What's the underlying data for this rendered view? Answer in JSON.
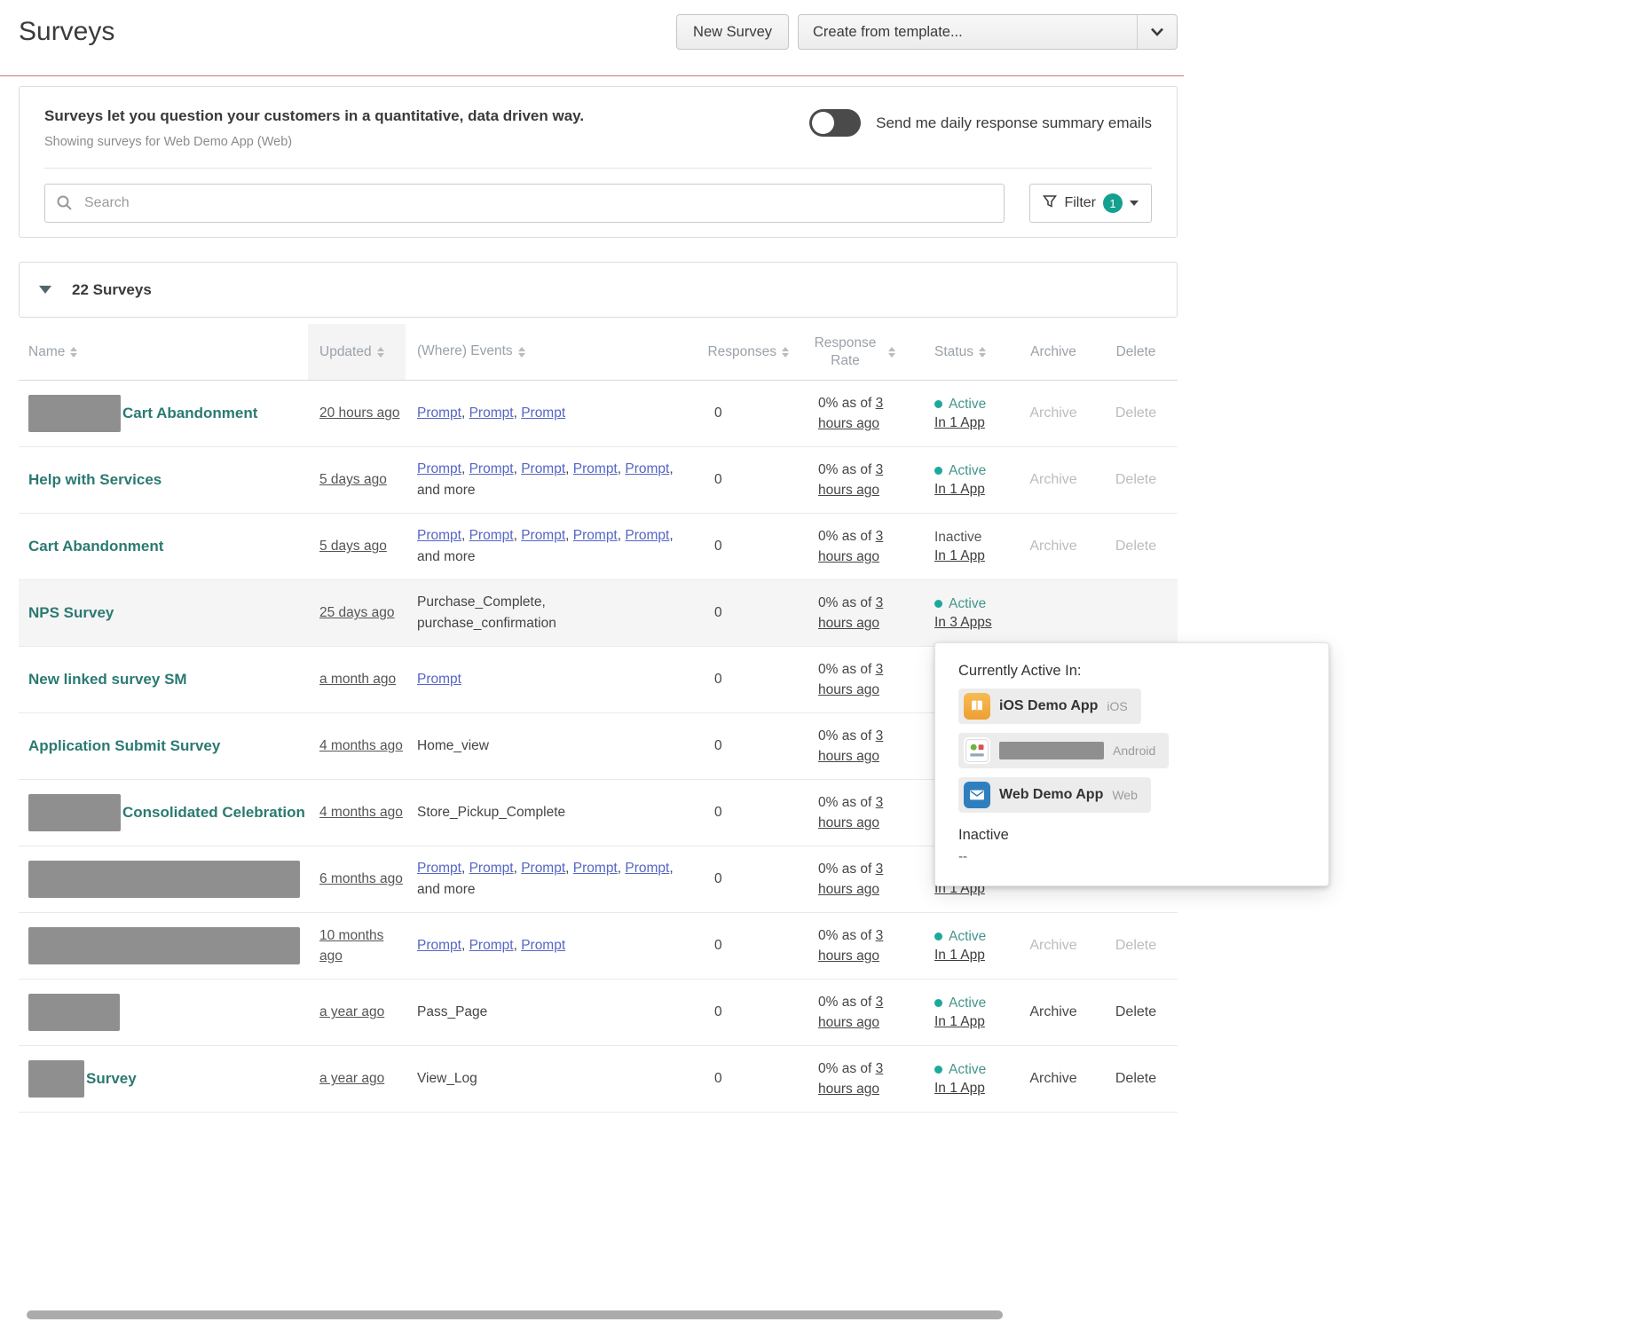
{
  "page": {
    "title": "Surveys",
    "new_survey_button": "New Survey",
    "template_dropdown": "Create from template..."
  },
  "banner": {
    "headline": "Surveys let you question your customers in a quantitative, data driven way.",
    "subtext": "Showing surveys for Web Demo App (Web)",
    "toggle_label": "Send me daily response summary emails",
    "toggle_on": false
  },
  "search": {
    "placeholder": "Search",
    "filter_label": "Filter",
    "filter_count": "1"
  },
  "list_header": {
    "count_label": "22 Surveys"
  },
  "table": {
    "more_label": "and more",
    "archive_label": "Archive",
    "delete_label": "Delete",
    "columns": [
      {
        "key": "name",
        "label": "Name",
        "sortable": true,
        "sorted": false
      },
      {
        "key": "updated",
        "label": "Updated",
        "sortable": true,
        "sorted": true
      },
      {
        "key": "events",
        "label": "(Where) Events",
        "sortable": true,
        "sorted": false
      },
      {
        "key": "responses",
        "label": "Responses",
        "sortable": true,
        "sorted": false
      },
      {
        "key": "response-rate",
        "label": "Response Rate",
        "sortable": true,
        "sorted": false
      },
      {
        "key": "status",
        "label": "Status",
        "sortable": true,
        "sorted": false
      },
      {
        "key": "archive",
        "label": "Archive",
        "sortable": false,
        "sorted": false
      },
      {
        "key": "delete",
        "label": "Delete",
        "sortable": false,
        "sorted": false
      }
    ],
    "rows": [
      {
        "redacted_width": 104,
        "name": "Cart Abandonment",
        "updated": "20 hours ago",
        "events": {
          "type": "links",
          "links": [
            "Prompt",
            "Prompt",
            "Prompt"
          ],
          "more": false
        },
        "responses": "0",
        "rate": {
          "prefix": "0% as of ",
          "link": "3 hours ago"
        },
        "status": {
          "visible": true,
          "dot": true,
          "label": "Active",
          "apps": "In 1 App"
        },
        "archive": {
          "visible": true,
          "muted": true
        },
        "delete": {
          "visible": true,
          "muted": true
        },
        "highlight": false
      },
      {
        "redacted_width": 0,
        "name": "Help with Services",
        "updated": "5 days ago",
        "events": {
          "type": "links",
          "links": [
            "Prompt",
            "Prompt",
            "Prompt",
            "Prompt",
            "Prompt"
          ],
          "more": true
        },
        "responses": "0",
        "rate": {
          "prefix": "0% as of ",
          "link": "3 hours ago"
        },
        "status": {
          "visible": true,
          "dot": true,
          "label": "Active",
          "apps": "In 1 App"
        },
        "archive": {
          "visible": true,
          "muted": true
        },
        "delete": {
          "visible": true,
          "muted": true
        },
        "highlight": false
      },
      {
        "redacted_width": 0,
        "name": "Cart Abandonment",
        "updated": "5 days ago",
        "events": {
          "type": "links",
          "links": [
            "Prompt",
            "Prompt",
            "Prompt",
            "Prompt",
            "Prompt"
          ],
          "more": true
        },
        "responses": "0",
        "rate": {
          "prefix": "0% as of ",
          "link": "3 hours ago"
        },
        "status": {
          "visible": true,
          "dot": false,
          "label": "Inactive",
          "apps": "In 1 App"
        },
        "archive": {
          "visible": true,
          "muted": true
        },
        "delete": {
          "visible": true,
          "muted": true
        },
        "highlight": false
      },
      {
        "redacted_width": 0,
        "name": "NPS Survey",
        "updated": "25 days ago",
        "events": {
          "type": "text",
          "text": "Purchase_Complete, purchase_confirmation"
        },
        "responses": "0",
        "rate": {
          "prefix": "0% as of ",
          "link": "3 hours ago"
        },
        "status": {
          "visible": true,
          "dot": true,
          "label": "Active",
          "apps": "In 3 Apps"
        },
        "archive": {
          "visible": false,
          "muted": false
        },
        "delete": {
          "visible": false,
          "muted": false
        },
        "highlight": true
      },
      {
        "redacted_width": 0,
        "name": "New linked survey SM",
        "updated": "a month ago",
        "events": {
          "type": "links",
          "links": [
            "Prompt"
          ],
          "more": false
        },
        "responses": "0",
        "rate": {
          "prefix": "0% as of ",
          "link": "3 hours ago"
        },
        "status": {
          "visible": false
        },
        "archive": {
          "visible": false
        },
        "delete": {
          "visible": false
        },
        "highlight": false
      },
      {
        "redacted_width": 0,
        "name": "Application Submit Survey",
        "updated": "4 months ago",
        "events": {
          "type": "text",
          "text": "Home_view"
        },
        "responses": "0",
        "rate": {
          "prefix": "0% as of ",
          "link": "3 hours ago"
        },
        "status": {
          "visible": false
        },
        "archive": {
          "visible": false
        },
        "delete": {
          "visible": false
        },
        "highlight": false
      },
      {
        "redacted_width": 104,
        "name": "Consolidated Celebration",
        "updated": "4 months ago",
        "events": {
          "type": "text",
          "text": "Store_Pickup_Complete"
        },
        "responses": "0",
        "rate": {
          "prefix": "0% as of ",
          "link": "3 hours ago"
        },
        "status": {
          "visible": false
        },
        "archive": {
          "visible": false
        },
        "delete": {
          "visible": false
        },
        "highlight": false
      },
      {
        "redacted_width": 306,
        "name": "",
        "updated": "6 months ago",
        "events": {
          "type": "links",
          "links": [
            "Prompt",
            "Prompt",
            "Prompt",
            "Prompt",
            "Prompt"
          ],
          "more": true
        },
        "responses": "0",
        "rate": {
          "prefix": "0% as of ",
          "link": "3 hours ago"
        },
        "status": {
          "visible": true,
          "dot": false,
          "label": "",
          "apps": "In 1 App"
        },
        "archive": {
          "visible": false
        },
        "delete": {
          "visible": false
        },
        "highlight": false
      },
      {
        "redacted_width": 306,
        "name": "",
        "updated": "10 months ago",
        "events": {
          "type": "links",
          "links": [
            "Prompt",
            "Prompt",
            "Prompt"
          ],
          "more": false
        },
        "responses": "0",
        "rate": {
          "prefix": "0% as of ",
          "link": "3 hours ago"
        },
        "status": {
          "visible": true,
          "dot": true,
          "label": "Active",
          "apps": "In 1 App"
        },
        "archive": {
          "visible": true,
          "muted": true
        },
        "delete": {
          "visible": true,
          "muted": true
        },
        "highlight": false
      },
      {
        "redacted_width": 103,
        "name": "",
        "updated": "a year ago",
        "events": {
          "type": "text",
          "text": "Pass_Page"
        },
        "responses": "0",
        "rate": {
          "prefix": "0% as of ",
          "link": "3 hours ago"
        },
        "status": {
          "visible": true,
          "dot": true,
          "label": "Active",
          "apps": "In 1 App"
        },
        "archive": {
          "visible": true,
          "muted": false
        },
        "delete": {
          "visible": true,
          "muted": false
        },
        "highlight": false
      },
      {
        "redacted_width": 63,
        "name": "Survey",
        "updated": "a year ago",
        "events": {
          "type": "text",
          "text": "View_Log"
        },
        "responses": "0",
        "rate": {
          "prefix": "0% as of ",
          "link": "3 hours ago"
        },
        "status": {
          "visible": true,
          "dot": true,
          "label": "Active",
          "apps": "In 1 App"
        },
        "archive": {
          "visible": true,
          "muted": false
        },
        "delete": {
          "visible": true,
          "muted": false
        },
        "highlight": false
      }
    ]
  },
  "popover": {
    "title": "Currently Active In:",
    "apps": [
      {
        "name": "iOS Demo App",
        "platform": "iOS",
        "redacted": false,
        "icon": "ios-app"
      },
      {
        "name": "",
        "platform": "Android",
        "redacted": true,
        "icon": "android-app"
      },
      {
        "name": "Web Demo App",
        "platform": "Web",
        "redacted": false,
        "icon": "web-app"
      }
    ],
    "inactive_label": "Inactive",
    "inactive_value": "--"
  }
}
